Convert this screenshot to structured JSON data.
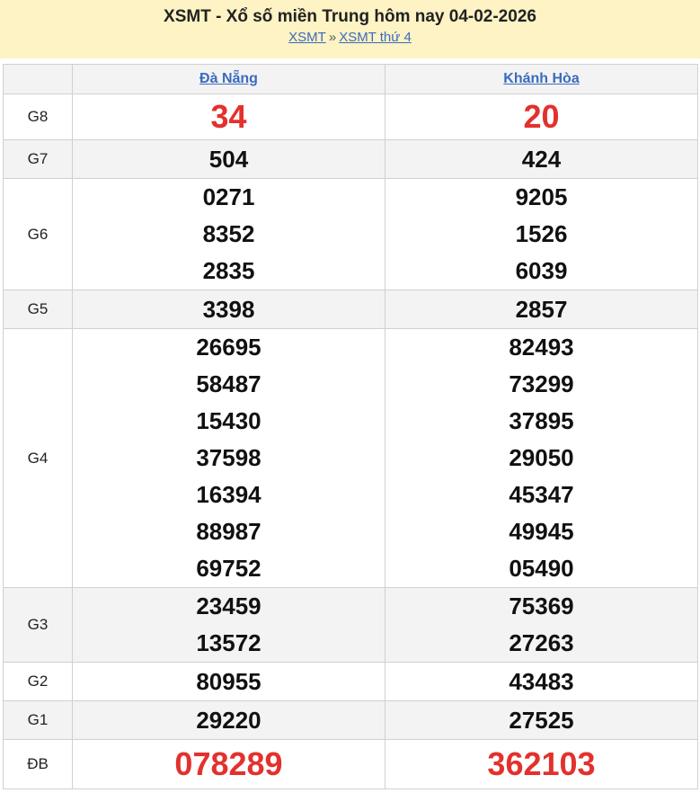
{
  "header": {
    "title": "XSMT - Xổ số miền Trung hôm nay 04-02-2026",
    "breadcrumb_home": "XSMT",
    "breadcrumb_sep": "»",
    "breadcrumb_current": "XSMT thứ 4"
  },
  "provinces": [
    "Đà Nẵng",
    "Khánh Hòa"
  ],
  "prizes": [
    {
      "label": "G8",
      "values": [
        [
          "34"
        ],
        [
          "20"
        ]
      ]
    },
    {
      "label": "G7",
      "values": [
        [
          "504"
        ],
        [
          "424"
        ]
      ]
    },
    {
      "label": "G6",
      "values": [
        [
          "0271",
          "8352",
          "2835"
        ],
        [
          "9205",
          "1526",
          "6039"
        ]
      ]
    },
    {
      "label": "G5",
      "values": [
        [
          "3398"
        ],
        [
          "2857"
        ]
      ]
    },
    {
      "label": "G4",
      "values": [
        [
          "26695",
          "58487",
          "15430",
          "37598",
          "16394",
          "88987",
          "69752"
        ],
        [
          "82493",
          "73299",
          "37895",
          "29050",
          "45347",
          "49945",
          "05490"
        ]
      ]
    },
    {
      "label": "G3",
      "values": [
        [
          "23459",
          "13572"
        ],
        [
          "75369",
          "27263"
        ]
      ]
    },
    {
      "label": "G2",
      "values": [
        [
          "80955"
        ],
        [
          "43483"
        ]
      ]
    },
    {
      "label": "G1",
      "values": [
        [
          "29220"
        ],
        [
          "27525"
        ]
      ]
    },
    {
      "label": "ĐB",
      "values": [
        [
          "078289"
        ],
        [
          "362103"
        ]
      ]
    }
  ],
  "colors": {
    "header_bg": "#fdf3c4",
    "link": "#3a6bbd",
    "highlight_red": "#e3312d",
    "row_shade": "#f3f3f3"
  }
}
